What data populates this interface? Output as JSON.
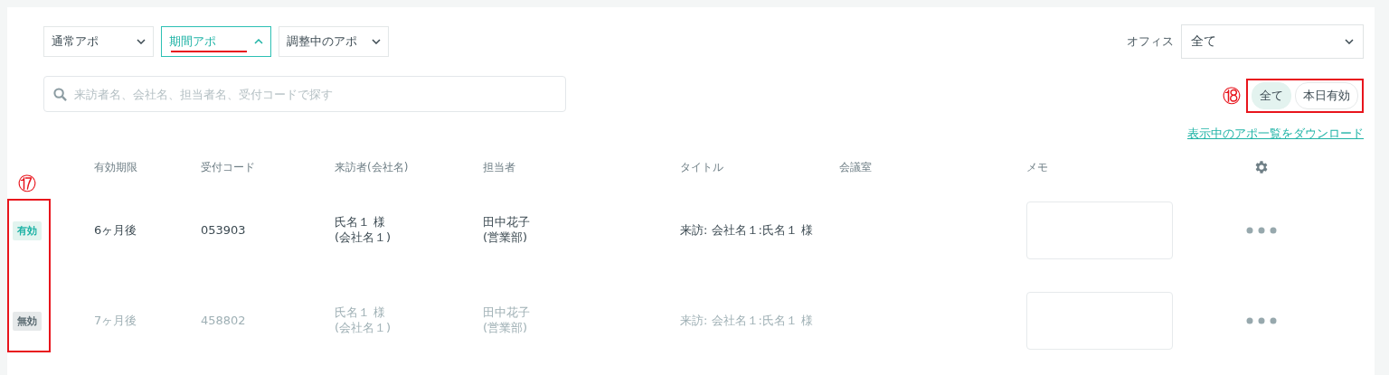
{
  "filters": [
    {
      "label": "通常アポ",
      "selected": false
    },
    {
      "label": "期間アポ",
      "selected": true
    },
    {
      "label": "調整中のアポ",
      "selected": false
    }
  ],
  "office": {
    "label": "オフィス",
    "value": "全て"
  },
  "search": {
    "placeholder": "来訪者名、会社名、担当者名、受付コードで探す"
  },
  "validity_toggle": {
    "annotation": "⑱",
    "options": [
      {
        "label": "全て",
        "selected": true
      },
      {
        "label": "本日有効",
        "selected": false
      }
    ]
  },
  "download_link": "表示中のアポ一覧をダウンロード",
  "table": {
    "annotation": "⑰",
    "columns": [
      "有効期限",
      "受付コード",
      "来訪者(会社名)",
      "担当者",
      "タイトル",
      "会議室",
      "メモ"
    ],
    "rows": [
      {
        "status": "有効",
        "active": true,
        "expiry": "6ヶ月後",
        "code": "053903",
        "visitor": "氏名１ 様",
        "company": "(会社名１)",
        "host": "田中花子",
        "department": "(営業部)",
        "title": "来訪: 会社名１:氏名１ 様"
      },
      {
        "status": "無効",
        "active": false,
        "expiry": "7ヶ月後",
        "code": "458802",
        "visitor": "氏名１ 様",
        "company": "(会社名１)",
        "host": "田中花子",
        "department": "(営業部)",
        "title": "来訪: 会社名１:氏名１ 様"
      }
    ]
  }
}
